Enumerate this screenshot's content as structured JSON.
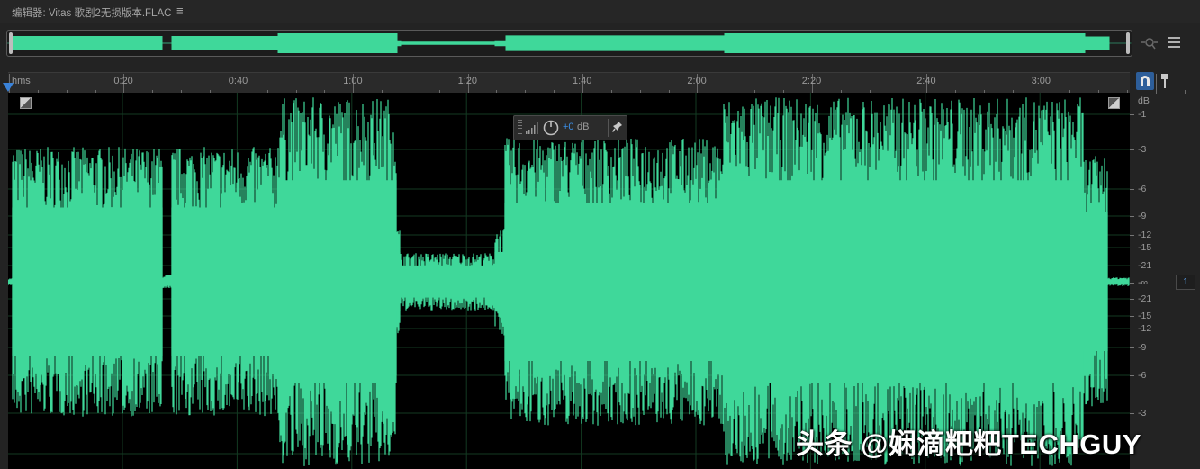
{
  "editor": {
    "title": "编辑器: Vitas 歌剧2无损版本.FLAC",
    "menu_glyph": "≡"
  },
  "colors": {
    "waveform": "#3fd89a",
    "background": "#000000",
    "accent": "#3a82d8"
  },
  "ruler": {
    "unit_label": "hms",
    "labels": [
      "0:20",
      "0:40",
      "1:00",
      "1:20",
      "1:40",
      "2:00",
      "2:20",
      "2:40",
      "3:00"
    ]
  },
  "hud": {
    "gain_value": "+0",
    "gain_unit": "dB"
  },
  "db_scale": {
    "header": "dB",
    "labels": [
      "-1",
      "-3",
      "-6",
      "-9",
      "-12",
      "-15",
      "-21",
      "-∞",
      "-21",
      "-15",
      "-12",
      "-9",
      "-6",
      "-3"
    ]
  },
  "channel_badge": "1",
  "icons": {
    "menu": "menu-icon",
    "zoom": "zoom-icon",
    "list": "list-icon",
    "snap": "snap-icon",
    "pin": "pin-icon",
    "meter": "meter-icon",
    "knob": "knob-icon"
  },
  "watermark": "头条 @娴滴粑粑TECHGUY"
}
